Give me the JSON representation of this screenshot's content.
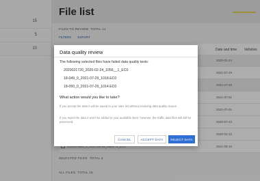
{
  "app": {
    "title": "File list",
    "sidebar_counts": [
      "15",
      "5",
      "10"
    ],
    "files_to_review_label": "FILES TO REVIEW",
    "files_to_review_count": "Total 11",
    "toolbar": {
      "filter_label": "FILTERS",
      "export_label": "EXPORT"
    },
    "table_headers": {
      "date": "Date and time",
      "vehicles": "Vehicles"
    },
    "rows": [
      {
        "date": "2020-02-24"
      },
      {
        "date": "2021-07-29"
      },
      {
        "date": "2021-07-29"
      },
      {
        "date": "2021-07-01"
      },
      {
        "date": "2021-07-01"
      },
      {
        "date": "2020-07-23"
      },
      {
        "date": "2020-02-22"
      },
      {
        "date": "2021-08-18",
        "file": "2021070501_0_2021-08-18_0800...3_EC0"
      }
    ],
    "selected_files_label": "SELECTED FILES",
    "selected_files_count": "Total 3",
    "all_files_label": "ALL FILES",
    "all_files_count": "Total 15"
  },
  "dialog": {
    "title": "Data quality review",
    "intro": "The following selected files have failed data quality tests:",
    "files": [
      "2020021720_2020-02-24_1056__1_EC0",
      "18-049_0_2021-07-29_1018.EC0",
      "18-050_0_2021-07-29_1014.EC0"
    ],
    "question": "What action would you like to take?",
    "note_accept": "If you accept the data it will be saved to your sites list without resolving data quality issues.",
    "note_reject": "If you reject the data it won't be added to your available sites; however, the traffic data files will still be preserved.",
    "buttons": {
      "cancel": "CANCEL",
      "accept": "ACCEPT DATA",
      "reject": "REJECT DATA"
    }
  }
}
